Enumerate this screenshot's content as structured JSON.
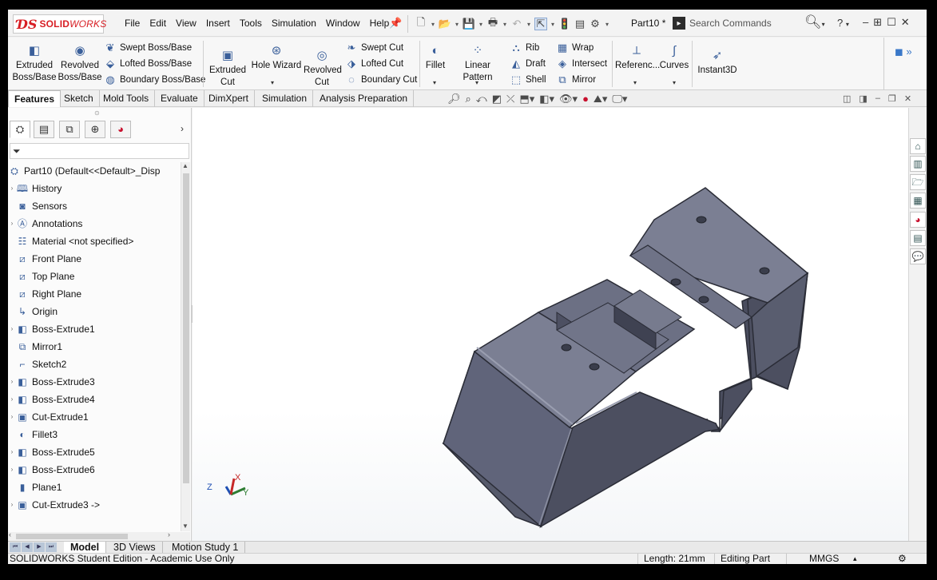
{
  "app": {
    "logo_ds": "ƊS",
    "logo_name_bold": "SOLID",
    "logo_name_italic": "WORKS",
    "doc_name": "Part10 *"
  },
  "menus": [
    "File",
    "Edit",
    "View",
    "Insert",
    "Tools",
    "Simulation",
    "Window",
    "Help"
  ],
  "search": {
    "placeholder": "Search Commands"
  },
  "help_label": "?",
  "ribbon": {
    "extruded_boss": "Extruded Boss/Base",
    "revolved_boss": "Revolved Boss/Base",
    "swept_boss": "Swept Boss/Base",
    "lofted_boss": "Lofted Boss/Base",
    "boundary_boss": "Boundary Boss/Base",
    "extruded_cut": "Extruded Cut",
    "hole_wizard": "Hole Wizard",
    "revolved_cut": "Revolved Cut",
    "swept_cut": "Swept Cut",
    "lofted_cut": "Lofted Cut",
    "boundary_cut": "Boundary Cut",
    "fillet": "Fillet",
    "linear_pattern": "Linear Pattern",
    "rib": "Rib",
    "draft": "Draft",
    "shell": "Shell",
    "wrap": "Wrap",
    "intersect": "Intersect",
    "mirror": "Mirror",
    "reference": "Referenc...",
    "curves": "Curves",
    "instant3d": "Instant3D"
  },
  "tabs": [
    "Features",
    "Sketch",
    "Mold Tools",
    "Evaluate",
    "DimXpert",
    "Simulation",
    "Analysis Preparation"
  ],
  "tree": {
    "root": "Part10  (Default<<Default>_Disp",
    "items": [
      {
        "label": "History",
        "icon": "history-icon",
        "expand": true
      },
      {
        "label": "Sensors",
        "icon": "sensors-icon",
        "expand": false
      },
      {
        "label": "Annotations",
        "icon": "annotations-icon",
        "expand": true
      },
      {
        "label": "Material <not specified>",
        "icon": "material-icon",
        "expand": false
      },
      {
        "label": "Front Plane",
        "icon": "plane-icon",
        "expand": false
      },
      {
        "label": "Top Plane",
        "icon": "plane-icon",
        "expand": false
      },
      {
        "label": "Right Plane",
        "icon": "plane-icon",
        "expand": false
      },
      {
        "label": "Origin",
        "icon": "origin-icon",
        "expand": false
      },
      {
        "label": "Boss-Extrude1",
        "icon": "boss-extrude-icon",
        "expand": true
      },
      {
        "label": "Mirror1",
        "icon": "mirror-icon",
        "expand": false
      },
      {
        "label": "Sketch2",
        "icon": "sketch-icon",
        "expand": false
      },
      {
        "label": "Boss-Extrude3",
        "icon": "boss-extrude-icon",
        "expand": true
      },
      {
        "label": "Boss-Extrude4",
        "icon": "boss-extrude-icon",
        "expand": true
      },
      {
        "label": "Cut-Extrude1",
        "icon": "cut-extrude-icon",
        "expand": true
      },
      {
        "label": "Fillet3",
        "icon": "fillet-icon",
        "expand": false
      },
      {
        "label": "Boss-Extrude5",
        "icon": "boss-extrude-icon",
        "expand": true
      },
      {
        "label": "Boss-Extrude6",
        "icon": "boss-extrude-icon",
        "expand": true
      },
      {
        "label": "Plane1",
        "icon": "plane1-icon",
        "expand": false
      },
      {
        "label": "Cut-Extrude3 ->",
        "icon": "cut-extrude-icon",
        "expand": true
      }
    ]
  },
  "triad": {
    "x": "X",
    "y": "Y",
    "z": "Z"
  },
  "bottom_tabs": [
    "Model",
    "3D Views",
    "Motion Study 1"
  ],
  "status": {
    "edition": "SOLIDWORKS Student Edition - Academic Use Only",
    "length": "Length: 21mm",
    "mode": "Editing Part",
    "units": "MMGS"
  },
  "colors": {
    "part_top": "#7b7f93",
    "part_side": "#5a5e70",
    "part_dark": "#3d4050",
    "brand": "#d81e24"
  }
}
